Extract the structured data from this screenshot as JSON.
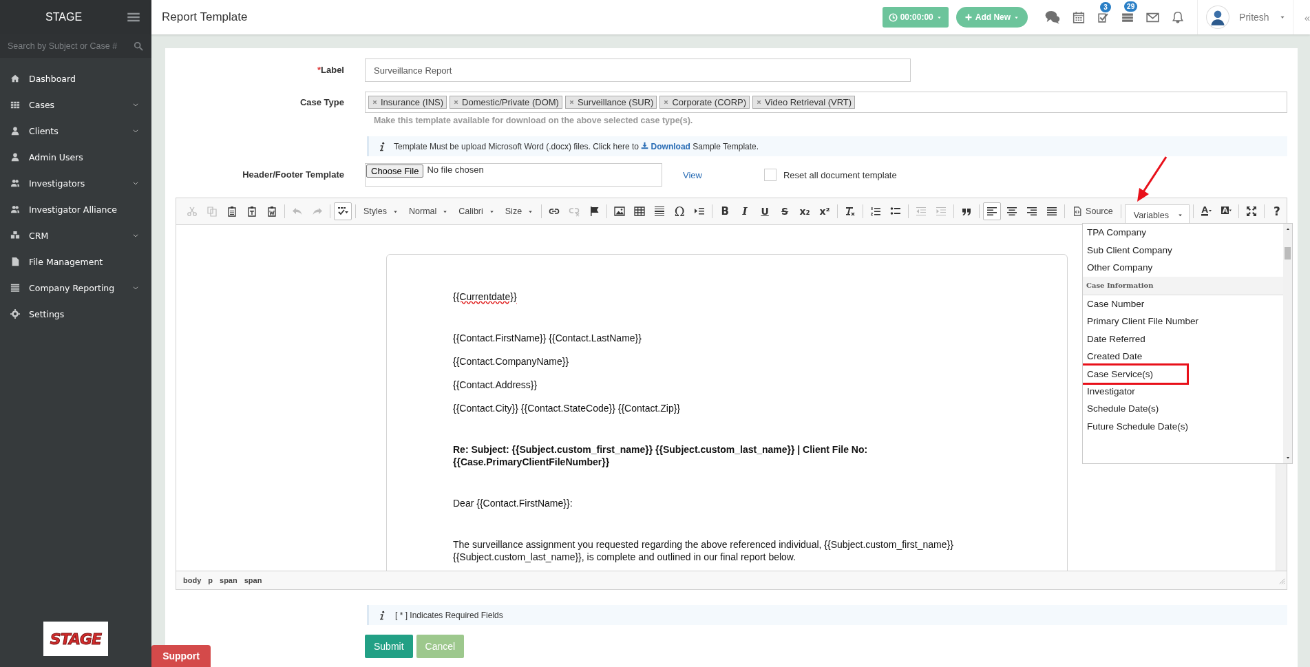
{
  "sidebar": {
    "brand": "STAGE",
    "search": {
      "placeholder": "Search by Subject or Case #"
    },
    "items": [
      {
        "label": "Dashboard",
        "expandable": false
      },
      {
        "label": "Cases",
        "expandable": true
      },
      {
        "label": "Clients",
        "expandable": true
      },
      {
        "label": "Admin Users",
        "expandable": false
      },
      {
        "label": "Investigators",
        "expandable": true
      },
      {
        "label": "Investigator Alliance",
        "expandable": false
      },
      {
        "label": "CRM",
        "expandable": true
      },
      {
        "label": "File Management",
        "expandable": false
      },
      {
        "label": "Company Reporting",
        "expandable": true
      },
      {
        "label": "Settings",
        "expandable": false
      }
    ],
    "logo": "STAGE",
    "support": "Support"
  },
  "topbar": {
    "title": "Report Template",
    "timer": "00:00:00",
    "add_new": "Add New",
    "task_badge": "3",
    "list_badge": "29",
    "user": "Pritesh",
    "collapse": "«"
  },
  "form": {
    "label_field": {
      "required_mark": "*",
      "label": "Label",
      "value": "Surveillance Report"
    },
    "case_type": {
      "label": "Case Type",
      "tags": [
        "Insurance (INS)",
        "Domestic/Private (DOM)",
        "Surveillance (SUR)",
        "Corporate (CORP)",
        "Video Retrieval (VRT)"
      ],
      "help": "Make this template available for download on the above selected case type(s)."
    },
    "notice": {
      "before": "Template Must be upload Microsoft Word (.docx) files. Click here to",
      "link": "Download",
      "after": "Sample Template."
    },
    "header_footer": {
      "label": "Header/Footer Template",
      "button": "Choose File",
      "file": "No file chosen",
      "view_link": "View",
      "reset": {
        "label": "Reset all document template",
        "checked": false
      }
    }
  },
  "editor": {
    "toolbar": [
      [
        {
          "kind": "icon",
          "disabled": true,
          "on": false
        },
        {
          "kind": "icon",
          "disabled": true,
          "on": false
        },
        {
          "kind": "icon",
          "disabled": false,
          "on": false
        },
        {
          "kind": "icon",
          "disabled": false,
          "on": false
        },
        {
          "kind": "icon",
          "disabled": false,
          "on": false
        }
      ],
      [
        {
          "kind": "icon",
          "disabled": true,
          "on": false
        },
        {
          "kind": "icon",
          "disabled": true,
          "on": false
        }
      ],
      [
        {
          "kind": "icon",
          "disabled": false,
          "on": true
        }
      ],
      [
        {
          "kind": "combo",
          "label": "Styles"
        },
        {
          "kind": "combo",
          "label": "Normal"
        },
        {
          "kind": "combo",
          "label": "Calibri"
        },
        {
          "kind": "combo",
          "label": "Size"
        }
      ],
      [
        {
          "kind": "icon",
          "disabled": false,
          "on": false
        },
        {
          "kind": "icon",
          "disabled": true,
          "on": false
        },
        {
          "kind": "icon",
          "disabled": false,
          "on": false
        }
      ],
      [
        {
          "kind": "icon",
          "disabled": false,
          "on": false
        },
        {
          "kind": "icon",
          "disabled": false,
          "on": false
        },
        {
          "kind": "icon",
          "disabled": false,
          "on": false
        },
        {
          "kind": "glyph",
          "label": "Ω",
          "disabled": false,
          "on": false
        },
        {
          "kind": "icon",
          "disabled": false,
          "on": false
        }
      ],
      [
        {
          "kind": "glyph",
          "label": "B",
          "disabled": false,
          "on": false
        },
        {
          "kind": "glyph",
          "label": "I",
          "disabled": false,
          "on": false
        },
        {
          "kind": "glyph",
          "label": "U",
          "disabled": false,
          "on": false
        },
        {
          "kind": "glyph",
          "label": "S",
          "disabled": false,
          "on": false
        },
        {
          "kind": "glyph",
          "label": "x₂",
          "disabled": false,
          "on": false
        },
        {
          "kind": "glyph",
          "label": "x²",
          "disabled": false,
          "on": false
        }
      ],
      [
        {
          "kind": "icon",
          "disabled": false,
          "on": false
        }
      ],
      [
        {
          "kind": "icon",
          "disabled": false,
          "on": false
        },
        {
          "kind": "icon",
          "disabled": false,
          "on": false
        }
      ],
      [
        {
          "kind": "icon",
          "disabled": true,
          "on": false
        },
        {
          "kind": "icon",
          "disabled": true,
          "on": false
        }
      ],
      [
        {
          "kind": "icon",
          "disabled": false,
          "on": false
        }
      ],
      [
        {
          "kind": "icon",
          "disabled": false,
          "on": true
        },
        {
          "kind": "icon",
          "disabled": false,
          "on": false
        },
        {
          "kind": "icon",
          "disabled": false,
          "on": false
        },
        {
          "kind": "icon",
          "disabled": false,
          "on": false
        }
      ],
      [
        {
          "kind": "text",
          "label": "Source"
        }
      ],
      [
        {
          "kind": "menu",
          "label": "Variables",
          "open": true
        }
      ],
      [
        {
          "kind": "icon",
          "disabled": false,
          "on": false
        },
        {
          "kind": "icon",
          "disabled": false,
          "on": false
        }
      ],
      [
        {
          "kind": "icon",
          "disabled": false,
          "on": false
        }
      ],
      [
        {
          "kind": "glyph",
          "label": "?",
          "disabled": false,
          "on": false
        }
      ]
    ],
    "variables_menu": [
      {
        "kind": "item",
        "label": "TPA Company",
        "highlighted": false
      },
      {
        "kind": "item",
        "label": "Sub Client Company",
        "highlighted": false
      },
      {
        "kind": "item",
        "label": "Other Company",
        "highlighted": false
      },
      {
        "kind": "header",
        "label": "Case Information"
      },
      {
        "kind": "item",
        "label": "Case Number",
        "highlighted": false
      },
      {
        "kind": "item",
        "label": "Primary Client File Number",
        "highlighted": false
      },
      {
        "kind": "item",
        "label": "Date Referred",
        "highlighted": false
      },
      {
        "kind": "item",
        "label": "Created Date",
        "highlighted": false
      },
      {
        "kind": "item",
        "label": "Case Service(s)",
        "highlighted": true
      },
      {
        "kind": "item",
        "label": "Investigator",
        "highlighted": false
      },
      {
        "kind": "item",
        "label": "Schedule Date(s)",
        "highlighted": false
      },
      {
        "kind": "item",
        "label": "Future Schedule Date(s)",
        "highlighted": false
      }
    ],
    "document": [
      {
        "kind": "line",
        "text": "{{Currentdate}}",
        "bold": false,
        "misspelled": true
      },
      {
        "kind": "para",
        "text": "{{Contact.FirstName}} {{Contact.LastName}}",
        "bold": false,
        "misspelled": false
      },
      {
        "kind": "line",
        "text": "{{Contact.CompanyName}}",
        "bold": false,
        "misspelled": false
      },
      {
        "kind": "line",
        "text": "{{Contact.Address}}",
        "bold": false,
        "misspelled": false
      },
      {
        "kind": "line",
        "text": "{{Contact.City}} {{Contact.StateCode}} {{Contact.Zip}}",
        "bold": false,
        "misspelled": false
      },
      {
        "kind": "para",
        "text": "Re: Subject: {{Subject.custom_first_name}} {{Subject.custom_last_name}} | Client File No: {{Case.PrimaryClientFileNumber}}",
        "bold": true,
        "misspelled": false
      },
      {
        "kind": "para",
        "text": "Dear {{Contact.FirstName}}:",
        "bold": false,
        "misspelled": false
      },
      {
        "kind": "para",
        "text": "The surveillance assignment you requested regarding the above referenced individual, {{Subject.custom_first_name}} {{Subject.custom_last_name}}, is complete and outlined in our final report below.",
        "bold": false,
        "misspelled": false
      }
    ],
    "path": [
      "body",
      "p",
      "span",
      "span"
    ]
  },
  "footer": {
    "notice": "[ * ] Indicates Required Fields",
    "submit": "Submit",
    "cancel": "Cancel"
  }
}
